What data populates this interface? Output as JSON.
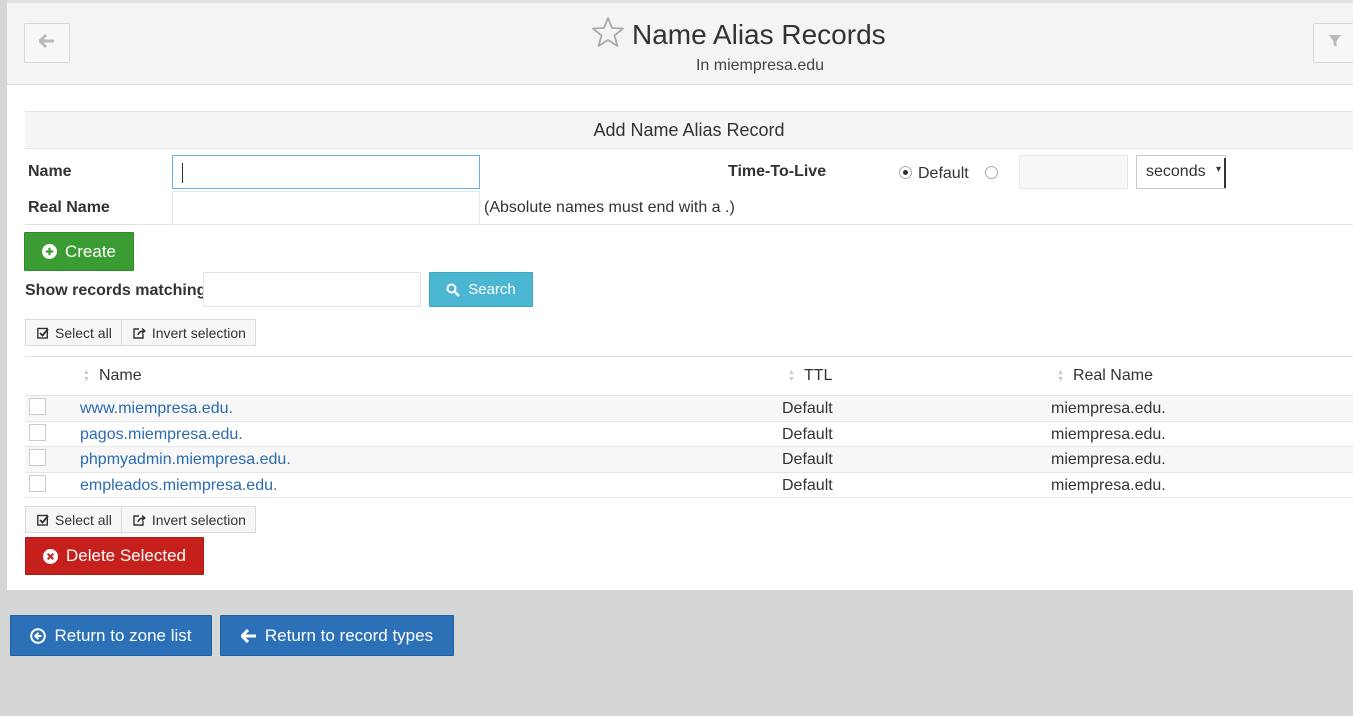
{
  "header": {
    "title": "Name Alias Records",
    "subtitle": "In miempresa.edu"
  },
  "form": {
    "heading": "Add Name Alias Record",
    "name_label": "Name",
    "real_name_label": "Real Name",
    "real_name_hint": "(Absolute names must end with a .)",
    "ttl_label": "Time-To-Live",
    "ttl_default_label": "Default",
    "ttl_unit": "seconds",
    "create_label": "Create"
  },
  "search": {
    "label": "Show records matching:",
    "button_label": "Search"
  },
  "selection": {
    "select_all": "Select all",
    "invert": "Invert selection"
  },
  "table": {
    "columns": [
      "Name",
      "TTL",
      "Real Name"
    ],
    "rows": [
      {
        "name": "www.miempresa.edu.",
        "ttl": "Default",
        "real": "miempresa.edu."
      },
      {
        "name": "pagos.miempresa.edu.",
        "ttl": "Default",
        "real": "miempresa.edu."
      },
      {
        "name": "phpmyadmin.miempresa.edu.",
        "ttl": "Default",
        "real": "miempresa.edu."
      },
      {
        "name": "empleados.miempresa.edu.",
        "ttl": "Default",
        "real": "miempresa.edu."
      }
    ]
  },
  "delete_label": "Delete Selected",
  "footer": {
    "return_zone": "Return to zone list",
    "return_types": "Return to record types"
  },
  "colors": {
    "green": "#3a9c33",
    "cyan": "#4bb6d2",
    "red": "#c5201c",
    "blue": "#2c71b7",
    "link": "#2c6bb0"
  },
  "icons": [
    "arrow-left-icon",
    "filter-icon",
    "star-icon",
    "plus-circle-icon",
    "search-icon",
    "check-square-icon",
    "share-square-icon",
    "times-circle-icon",
    "arrow-circle-left-icon"
  ]
}
